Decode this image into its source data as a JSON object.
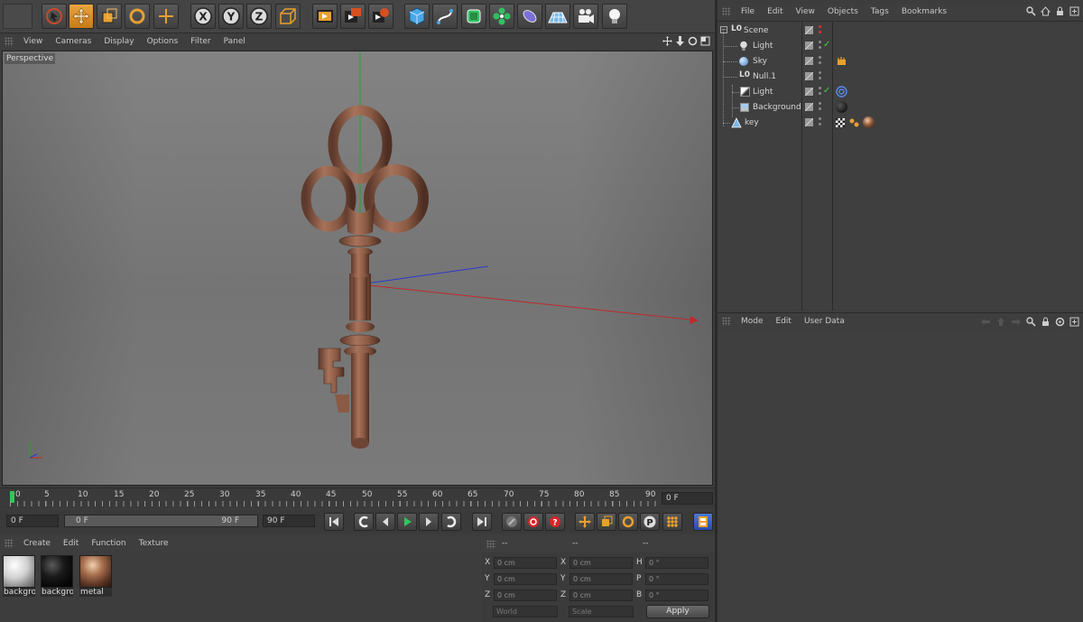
{
  "viewport": {
    "menu": [
      "View",
      "Cameras",
      "Display",
      "Options",
      "Filter",
      "Panel"
    ],
    "camera_label": "Perspective"
  },
  "toolbar": {
    "icons": [
      "undo-icon",
      "live-selection-icon",
      "move-icon",
      "scale-icon",
      "rotate-icon",
      "add-icon",
      "x-axis-lock-icon",
      "y-axis-lock-icon",
      "z-axis-lock-icon",
      "coordinate-system-icon",
      "render-view-icon",
      "render-to-picture-viewer-icon",
      "render-settings-icon",
      "cube-icon",
      "spline-pen-icon",
      "subdivision-surface-icon",
      "array-icon",
      "deformer-icon",
      "floor-icon",
      "camera-icon",
      "light-icon"
    ],
    "axis_labels": [
      "X",
      "Y",
      "Z"
    ]
  },
  "timeline": {
    "ticks": [
      "0",
      "5",
      "10",
      "15",
      "20",
      "25",
      "30",
      "35",
      "40",
      "45",
      "50",
      "55",
      "60",
      "65",
      "70",
      "75",
      "80",
      "85",
      "90"
    ],
    "current_frame": "0 F",
    "start_field": "0 F",
    "range_start": "0 F",
    "range_end": "90 F",
    "end_field": "90 F"
  },
  "materials": {
    "menu": [
      "Create",
      "Edit",
      "Function",
      "Texture"
    ],
    "items": [
      {
        "name": "backgrou",
        "color": "#f2f2f2"
      },
      {
        "name": "backgrou",
        "color": "#101010"
      },
      {
        "name": "metal",
        "color": "#8a5a3a"
      }
    ]
  },
  "coordinates": {
    "headers": [
      "--",
      "--",
      "--"
    ],
    "rows": [
      {
        "a": "X",
        "av": "0 cm",
        "b": "X",
        "bv": "0 cm",
        "c": "H",
        "cv": "0 °"
      },
      {
        "a": "Y",
        "av": "0 cm",
        "b": "Y",
        "bv": "0 cm",
        "c": "P",
        "cv": "0 °"
      },
      {
        "a": "Z",
        "av": "0 cm",
        "b": "Z",
        "bv": "0 cm",
        "c": "B",
        "cv": "0 °"
      }
    ],
    "mode_select": "World",
    "scale_select": "Scale",
    "apply": "Apply"
  },
  "object_manager": {
    "menu": [
      "File",
      "Edit",
      "View",
      "Objects",
      "Tags",
      "Bookmarks"
    ],
    "objects": [
      {
        "name": "Scene",
        "icon": "null-icon",
        "indent": 0
      },
      {
        "name": "Light",
        "icon": "light-bulb-icon",
        "indent": 1
      },
      {
        "name": "Sky",
        "icon": "sky-icon",
        "indent": 1
      },
      {
        "name": "Null.1",
        "icon": "null-icon",
        "indent": 1
      },
      {
        "name": "Light",
        "icon": "area-light-icon",
        "indent": 1
      },
      {
        "name": "Background",
        "icon": "background-icon",
        "indent": 1
      },
      {
        "name": "key",
        "icon": "polygon-object-icon",
        "indent": 0
      }
    ]
  },
  "attributes": {
    "menu": [
      "Mode",
      "Edit",
      "User Data"
    ]
  },
  "colors": {
    "accent": "#e9a540",
    "bg": "#3d3d3d",
    "axis_x": "#c0282a",
    "axis_y": "#2aa32a",
    "axis_z": "#2a3acb",
    "key": "#8b5a44"
  }
}
